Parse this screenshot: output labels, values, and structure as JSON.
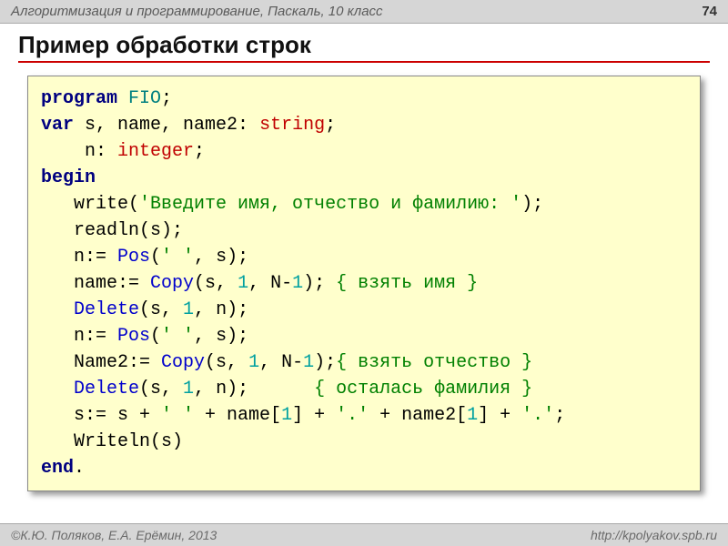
{
  "header": {
    "course": "Алгоритмизация и программирование, Паскаль, 10 класс",
    "page": "74"
  },
  "title": "Пример обработки строк",
  "code": {
    "l1": {
      "kw1": "program",
      "id1": "FIO",
      "t1": ";"
    },
    "l2": {
      "kw1": "var",
      "t1": " s, name, name2: ",
      "ty1": "string",
      "t2": ";"
    },
    "l3": {
      "t1": "    n: ",
      "ty1": "integer",
      "t2": ";"
    },
    "l4": {
      "kw1": "begin"
    },
    "l5": {
      "t1": "   write(",
      "str1": "'Введите имя, отчество и фамилию: '",
      "t2": ");"
    },
    "l6": {
      "t1": "   readln(s);"
    },
    "l7": {
      "t1": "   n:= ",
      "fn1": "Pos",
      "t2": "(",
      "str1": "' '",
      "t3": ", s);"
    },
    "l8": {
      "t1": "   name:= ",
      "fn1": "Copy",
      "t2": "(s, ",
      "n1": "1",
      "t3": ", N-",
      "n2": "1",
      "t4": "); ",
      "cmt1": "{ взять имя }"
    },
    "l9": {
      "t1": "   ",
      "fn1": "Delete",
      "t2": "(s, ",
      "n1": "1",
      "t3": ", n);"
    },
    "l10": {
      "t1": "   n:= ",
      "fn1": "Pos",
      "t2": "(",
      "str1": "' '",
      "t3": ", s);"
    },
    "l11": {
      "t1": "   Name2:= ",
      "fn1": "Copy",
      "t2": "(s, ",
      "n1": "1",
      "t3": ", N-",
      "n2": "1",
      "t4": ");",
      "cmt1": "{ взять отчество }"
    },
    "l12": {
      "t1": "   ",
      "fn1": "Delete",
      "t2": "(s, ",
      "n1": "1",
      "t3": ", n);      ",
      "cmt1": "{ осталась фамилия }"
    },
    "l13": {
      "t1": "   s:= s + ",
      "str1": "' '",
      "t2": " + name[",
      "n1": "1",
      "t3": "] + ",
      "str2": "'.'",
      "t4": " + name2[",
      "n2": "1",
      "t5": "] + ",
      "str3": "'.'",
      "t6": ";"
    },
    "l14": {
      "t1": "   Writeln(s)"
    },
    "l15": {
      "kw1": "end",
      "t1": "."
    }
  },
  "footer": {
    "copyright": "©К.Ю. Поляков, Е.А. Ерёмин, 2013",
    "url": "http://kpolyakov.spb.ru"
  }
}
